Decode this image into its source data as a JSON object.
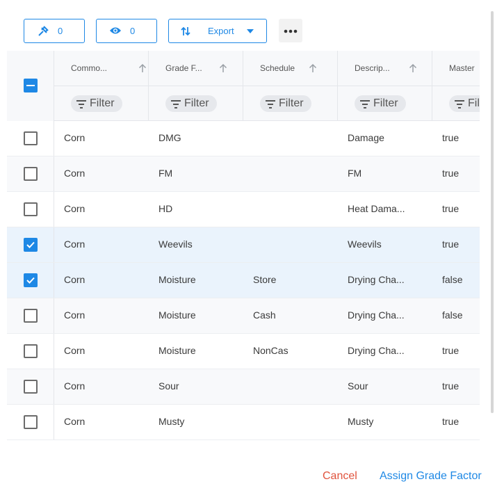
{
  "toolbar": {
    "pinned_count": "0",
    "visible_count": "0",
    "export_label": "Export"
  },
  "columns": [
    {
      "label": "Commo..."
    },
    {
      "label": "Grade F..."
    },
    {
      "label": "Schedule"
    },
    {
      "label": "Descrip..."
    },
    {
      "label": "Master"
    }
  ],
  "filter_placeholder": "Filter",
  "rows": [
    {
      "commodity": "Corn",
      "grade_factor": "DMG",
      "schedule": "",
      "description": "Damage",
      "master": "true",
      "selected": false
    },
    {
      "commodity": "Corn",
      "grade_factor": "FM",
      "schedule": "",
      "description": "FM",
      "master": "true",
      "selected": false
    },
    {
      "commodity": "Corn",
      "grade_factor": "HD",
      "schedule": "",
      "description": "Heat Dama...",
      "master": "true",
      "selected": false
    },
    {
      "commodity": "Corn",
      "grade_factor": "Weevils",
      "schedule": "",
      "description": "Weevils",
      "master": "true",
      "selected": true
    },
    {
      "commodity": "Corn",
      "grade_factor": "Moisture",
      "schedule": "Store",
      "description": "Drying Cha...",
      "master": "false",
      "selected": true
    },
    {
      "commodity": "Corn",
      "grade_factor": "Moisture",
      "schedule": "Cash",
      "description": "Drying Cha...",
      "master": "false",
      "selected": false
    },
    {
      "commodity": "Corn",
      "grade_factor": "Moisture",
      "schedule": "NonCas",
      "description": "Drying Cha...",
      "master": "true",
      "selected": false
    },
    {
      "commodity": "Corn",
      "grade_factor": "Sour",
      "schedule": "",
      "description": "Sour",
      "master": "true",
      "selected": false
    },
    {
      "commodity": "Corn",
      "grade_factor": "Musty",
      "schedule": "",
      "description": "Musty",
      "master": "true",
      "selected": false
    }
  ],
  "footer": {
    "cancel_label": "Cancel",
    "assign_label": "Assign Grade Factor"
  },
  "colors": {
    "accent": "#1e88e5",
    "cancel": "#e0533d",
    "selected_row": "#eaf3fc"
  }
}
